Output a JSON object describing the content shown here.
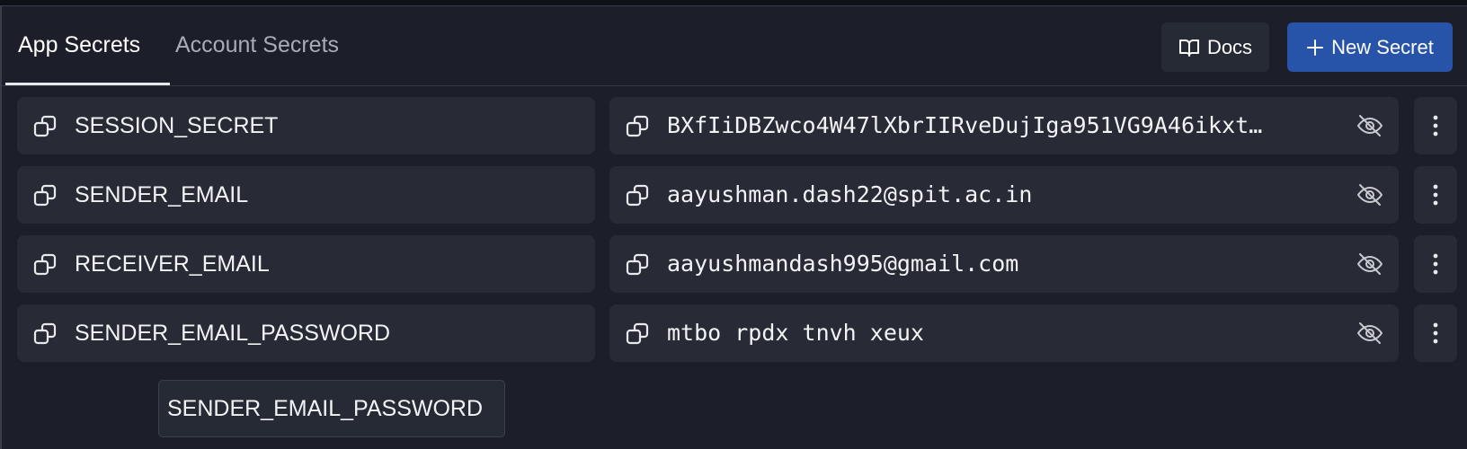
{
  "tabs": [
    {
      "label": "App Secrets",
      "active": true
    },
    {
      "label": "Account Secrets",
      "active": false
    }
  ],
  "toolbar": {
    "docs_label": "Docs",
    "docs_icon": "book-open-icon",
    "new_label": "New Secret",
    "new_icon": "plus-icon"
  },
  "secrets": [
    {
      "name": "SESSION_SECRET",
      "value": "BXfIiDBZwco4W47lXbrIIRveDujIga951VG9A46ikxt…"
    },
    {
      "name": "SENDER_EMAIL",
      "value": "aayushman.dash22@spit.ac.in"
    },
    {
      "name": "RECEIVER_EMAIL",
      "value": "aayushmandash995@gmail.com"
    },
    {
      "name": "SENDER_EMAIL_PASSWORD",
      "value": "mtbo rpdx tnvh xeux"
    }
  ],
  "tooltip": {
    "text": "SENDER_EMAIL_PASSWORD"
  },
  "colors": {
    "background": "#1c1f29",
    "cell": "#282b36",
    "accent": "#2754a8",
    "text": "#f2f3f5",
    "muted_text": "#a9acb5"
  },
  "icons": {
    "copy": "copy-icon",
    "reveal": "eye-off-icon",
    "menu": "more-vertical-icon"
  }
}
